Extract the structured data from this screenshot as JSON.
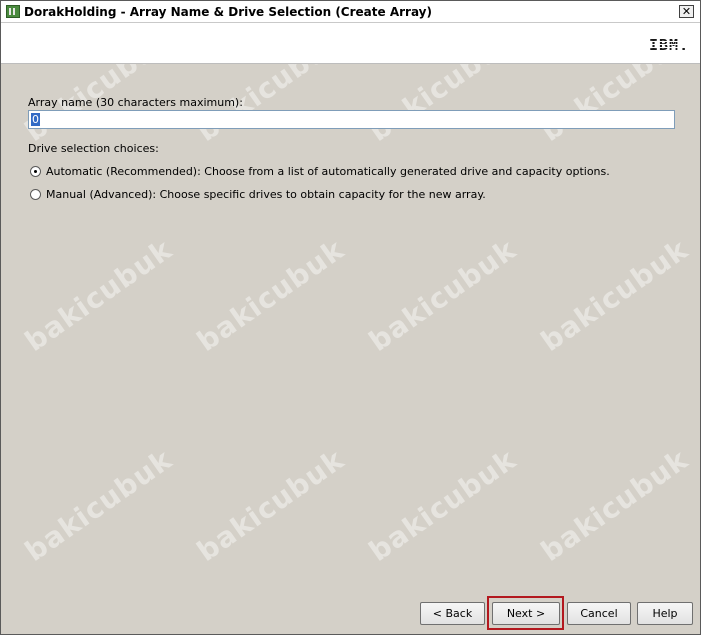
{
  "window": {
    "title": "DorakHolding - Array Name & Drive Selection (Create Array)",
    "close_glyph": "✕"
  },
  "banner": {
    "logo_text": "IBM."
  },
  "form": {
    "array_name_label": "Array name (30 characters maximum):",
    "array_name_value": "0",
    "drive_choices_label": "Drive selection choices:",
    "options": [
      {
        "label": "Automatic (Recommended): Choose from a list of automatically generated drive and capacity options.",
        "selected": true
      },
      {
        "label": "Manual (Advanced): Choose specific drives to obtain capacity for the new array.",
        "selected": false
      }
    ]
  },
  "buttons": {
    "back": "< Back",
    "next": "Next >",
    "cancel": "Cancel",
    "help": "Help"
  },
  "watermark_text": "bakicubuk",
  "colors": {
    "highlight": "#b3181f",
    "selection": "#316ac5"
  }
}
